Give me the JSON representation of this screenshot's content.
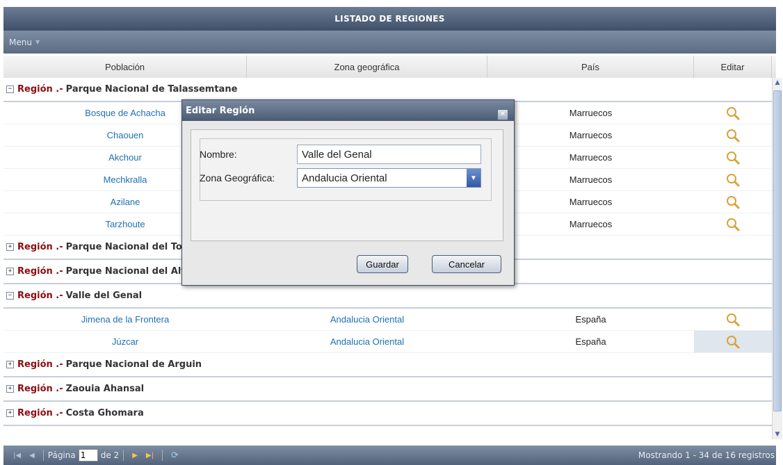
{
  "window": {
    "title": "LISTADO DE REGIONES"
  },
  "menu": {
    "label": "Menu"
  },
  "columns": {
    "poblacion": "Población",
    "zona": "Zona geográfica",
    "pais": "País",
    "editar": "Editar"
  },
  "group_prefix": "Región .-",
  "groups": [
    {
      "name": "Parque Nacional de Talassemtane",
      "expanded": true
    },
    {
      "name": "Parque Nacional del Toubkal",
      "expanded": false
    },
    {
      "name": "Parque Nacional del Alto Atlas Oriental",
      "expanded": false
    },
    {
      "name": "Valle del Genal",
      "expanded": true
    },
    {
      "name": "Parque Nacional de Arguin",
      "expanded": false
    },
    {
      "name": "Zaouia Ahansal",
      "expanded": false
    },
    {
      "name": "Costa Ghomara",
      "expanded": false
    }
  ],
  "talassemtane_rows": [
    {
      "poblacion": "Bosque de Achacha",
      "zona": "",
      "pais": "Marruecos"
    },
    {
      "poblacion": "Chaouen",
      "zona": "",
      "pais": "Marruecos"
    },
    {
      "poblacion": "Akchour",
      "zona": "",
      "pais": "Marruecos"
    },
    {
      "poblacion": "Mechkralla",
      "zona": "",
      "pais": "Marruecos"
    },
    {
      "poblacion": "Azilane",
      "zona": "",
      "pais": "Marruecos"
    },
    {
      "poblacion": "Tarzhoute",
      "zona": "",
      "pais": "Marruecos"
    }
  ],
  "genal_rows": [
    {
      "poblacion": "Jimena de la Frontera",
      "zona": "Andalucia Oriental",
      "pais": "España"
    },
    {
      "poblacion": "Júzcar",
      "zona": "Andalucia Oriental",
      "pais": "España"
    }
  ],
  "pager": {
    "page_label": "Página",
    "page_value": "1",
    "of_label": "de 2",
    "info": "Mostrando 1 - 34 de 16 registros"
  },
  "dialog": {
    "title": "Editar Región",
    "nombre_label": "Nombre:",
    "nombre_value": "Valle del Genal",
    "zona_label": "Zona Geográfica:",
    "zona_value": "Andalucia Oriental",
    "save_label": "Guardar",
    "cancel_label": "Cancelar"
  },
  "icons": {
    "edit": "magnifier-icon",
    "toggle_open": "collapse-icon",
    "toggle_closed": "expand-icon"
  },
  "colors": {
    "header": "#4a5b73",
    "group_label": "#8b0e12",
    "link": "#1f6fb2",
    "edit_icon": "#d8a23a"
  }
}
